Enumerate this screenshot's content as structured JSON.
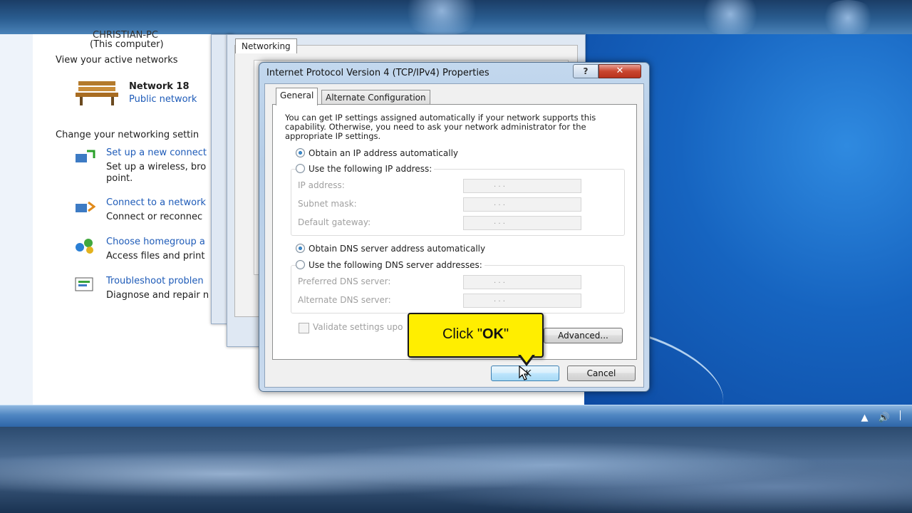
{
  "control_panel": {
    "computer_name": "CHRISTIAN-PC",
    "computer_sub": "(This computer)",
    "active_networks_label": "View your active networks",
    "network_name": "Network  18",
    "network_type": "Public network",
    "change_settings_label": "Change your networking settin",
    "tasks": [
      {
        "link": "Set up a new connect",
        "desc": "Set up a wireless, bro",
        "desc2": "point."
      },
      {
        "link": "Connect to a network",
        "desc": "Connect or reconnec"
      },
      {
        "link": "Choose homegroup a",
        "desc": "Access files and print"
      },
      {
        "link": "Troubleshoot problen",
        "desc": "Diagnose and repair n"
      }
    ]
  },
  "background_window": {
    "tab_label": "Networking"
  },
  "dialog": {
    "title": "Internet Protocol Version 4 (TCP/IPv4) Properties",
    "help_label": "?",
    "close_label": "✕",
    "tabs": [
      {
        "label": "General",
        "active": true
      },
      {
        "label": "Alternate Configuration",
        "active": false
      }
    ],
    "description": "You can get IP settings assigned automatically if your network supports this capability. Otherwise, you need to ask your network administrator for the appropriate IP settings.",
    "ip_options": [
      {
        "label": "Obtain an IP address automatically",
        "selected": true
      },
      {
        "label": "Use the following IP address:",
        "selected": false
      }
    ],
    "ip_fields": [
      {
        "label": "IP address:",
        "value": ". . ."
      },
      {
        "label": "Subnet mask:",
        "value": ". . ."
      },
      {
        "label": "Default gateway:",
        "value": ". . ."
      }
    ],
    "dns_options": [
      {
        "label": "Obtain DNS server address automatically",
        "selected": true
      },
      {
        "label": "Use the following DNS server addresses:",
        "selected": false
      }
    ],
    "dns_fields": [
      {
        "label": "Preferred DNS server:",
        "value": ". . ."
      },
      {
        "label": "Alternate DNS server:",
        "value": ". . ."
      }
    ],
    "validate_label": "Validate settings upo",
    "advanced_label": "Advanced...",
    "ok_label": "OK",
    "cancel_label": "Cancel"
  },
  "callout": {
    "prefix": "Click \"",
    "emphasis": "OK",
    "suffix": "\""
  },
  "tray": {
    "icons": [
      "arrow-up-icon",
      "speaker-icon"
    ]
  },
  "colors": {
    "callout_yellow": "#ffee00",
    "link_blue": "#1e5bb8",
    "desktop_blue": "#1664c0"
  }
}
